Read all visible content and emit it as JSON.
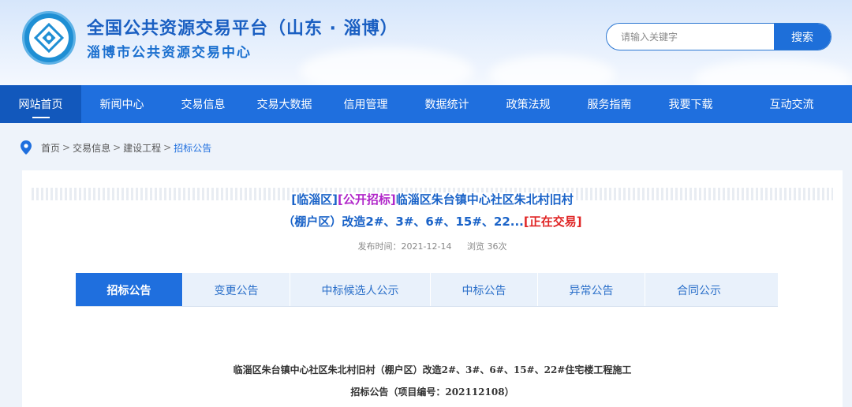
{
  "header": {
    "title": "全国公共资源交易平台（山东 · 淄博）",
    "subtitle": "淄博市公共资源交易中心",
    "logo_icon": "emblem-icon"
  },
  "search": {
    "placeholder": "请输入关键字",
    "button_label": "搜索"
  },
  "nav": {
    "items": [
      {
        "label": "网站首页",
        "active": true
      },
      {
        "label": "新闻中心"
      },
      {
        "label": "交易信息"
      },
      {
        "label": "交易大数据"
      },
      {
        "label": "信用管理"
      },
      {
        "label": "数据统计"
      },
      {
        "label": "政策法规"
      },
      {
        "label": "服务指南"
      },
      {
        "label": "我要下载"
      },
      {
        "label": "互动交流"
      }
    ]
  },
  "breadcrumb": {
    "items": [
      "首页",
      "交易信息",
      "建设工程"
    ],
    "current": "招标公告",
    "separator": ">"
  },
  "article": {
    "tag_area": "[临淄区]",
    "tag_type": "[公开招标]",
    "title_part1": "临淄区朱台镇中心社区朱北村旧村",
    "title_part2": "（棚户区）改造2#、3#、6#、15#、22...",
    "tag_status": "[正在交易]",
    "publish_time": "发布时间：2021-12-14",
    "views": "浏览 36次"
  },
  "tabs": [
    {
      "label": "招标公告",
      "active": true
    },
    {
      "label": "变更公告"
    },
    {
      "label": "中标候选人公示"
    },
    {
      "label": "中标公告"
    },
    {
      "label": "异常公告"
    },
    {
      "label": "合同公示"
    }
  ],
  "document": {
    "heading": "临淄区朱台镇中心社区朱北村旧村（棚户区）改造2#、3#、6#、15#、22#住宅楼工程施工",
    "subheading": "招标公告（项目编号：202112108）"
  },
  "colors": {
    "primary": "#1f6fde",
    "nav_active": "#1258bc",
    "tag_purple": "#b027c9",
    "tag_red": "#e02525"
  }
}
